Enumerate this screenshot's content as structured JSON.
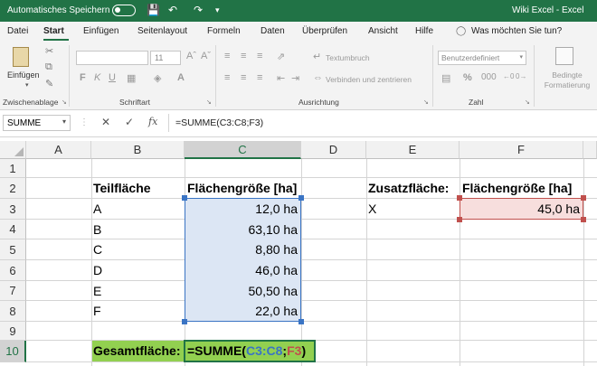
{
  "titlebar": {
    "autosave_label": "Automatisches Speichern",
    "title": "Wiki Excel  -  Excel"
  },
  "tabs": [
    "Datei",
    "Start",
    "Einfügen",
    "Seitenlayout",
    "Formeln",
    "Daten",
    "Überprüfen",
    "Ansicht",
    "Hilfe"
  ],
  "tell_me": "Was möchten Sie tun?",
  "ribbon": {
    "paste_label": "Einfügen",
    "clipboard_group": "Zwischenablage",
    "font_group": "Schriftart",
    "font_size": "11",
    "alignment_group": "Ausrichtung",
    "wrap_text": "Textumbruch",
    "merge_center": "Verbinden und zentrieren",
    "number_group": "Zahl",
    "number_format": "Benutzerdefiniert",
    "conditional_format": "Bedingte Formatierung"
  },
  "formula_bar": {
    "name_box": "SUMME",
    "formula": "=SUMME(C3:C8;F3)"
  },
  "columns": [
    "A",
    "B",
    "C",
    "D",
    "E",
    "F"
  ],
  "rows": [
    "1",
    "2",
    "3",
    "4",
    "5",
    "6",
    "7",
    "8",
    "9",
    "10"
  ],
  "cells": {
    "B2": "Teilfläche",
    "C2": "Flächengröße [ha]",
    "E2": "Zusatzfläche:",
    "F2": "Flächengröße [ha]",
    "B3": "A",
    "C3": "12,0 ha",
    "B4": "B",
    "C4": "63,10 ha",
    "B5": "C",
    "C5": "8,80 ha",
    "B6": "D",
    "C6": "46,0 ha",
    "B7": "E",
    "C7": "50,50 ha",
    "B8": "F",
    "C8": "22,0 ha",
    "E3": "X",
    "F3": "45,0 ha",
    "B10": "Gesamtfläche:"
  },
  "formula_parts": {
    "prefix": "=SUMME(",
    "ref1": "C3:C8",
    "sep": ";",
    "ref2": "F3",
    "suffix": ")"
  },
  "colors": {
    "excel_green": "#217346",
    "range1": "#3a74c4",
    "range2": "#c0504d",
    "total_fill": "#92d050"
  }
}
